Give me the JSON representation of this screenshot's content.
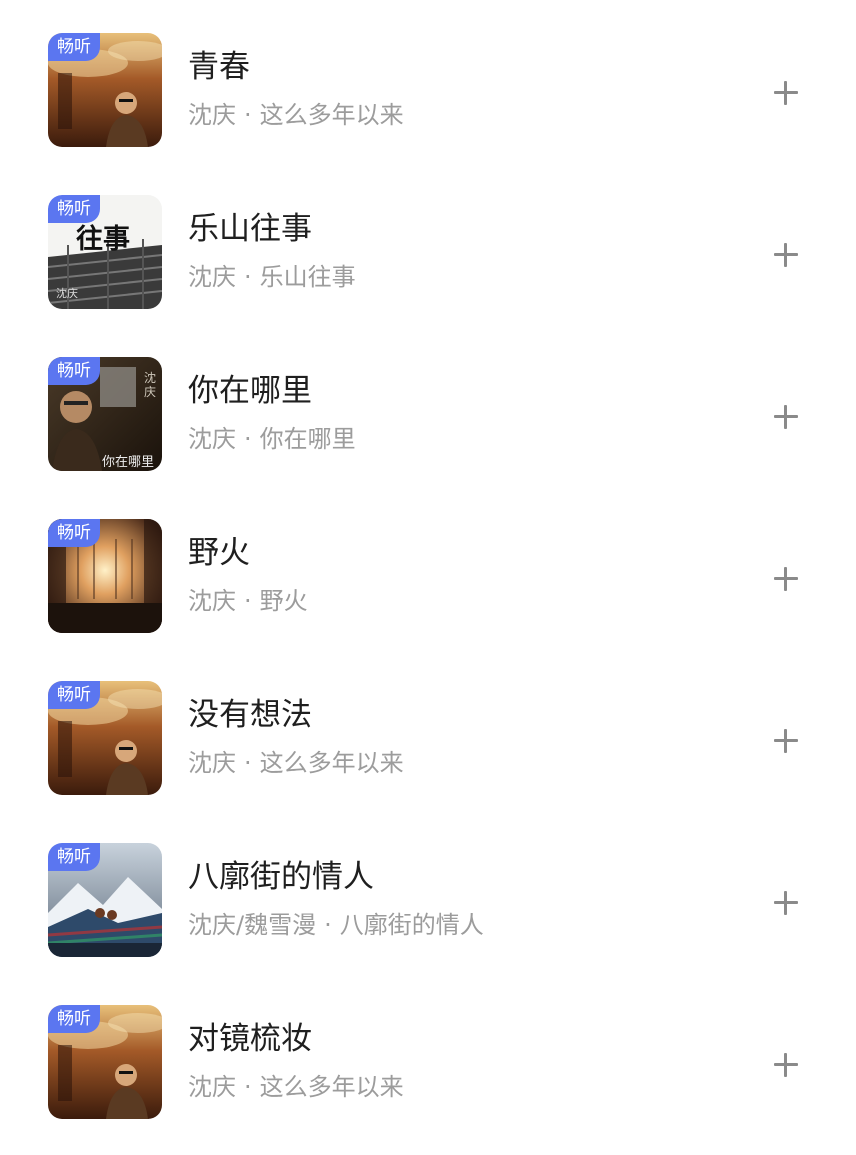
{
  "songs": [
    {
      "title": "青春",
      "artist": "沈庆",
      "album": "这么多年以来",
      "badge": "畅听",
      "cover": "cover-dusk-portrait"
    },
    {
      "title": "乐山往事",
      "artist": "沈庆",
      "album": "乐山往事",
      "badge": "畅听",
      "cover": "cover-rooftops",
      "cover_text": [
        "往事",
        "沈庆"
      ]
    },
    {
      "title": "你在哪里",
      "artist": "沈庆",
      "album": "你在哪里",
      "badge": "畅听",
      "cover": "cover-dark-portrait",
      "cover_text": [
        "沈庆",
        "你在哪里"
      ]
    },
    {
      "title": "野火",
      "artist": "沈庆",
      "album": "野火",
      "badge": "畅听",
      "cover": "cover-sunset-window"
    },
    {
      "title": "没有想法",
      "artist": "沈庆",
      "album": "这么多年以来",
      "badge": "畅听",
      "cover": "cover-dusk-portrait"
    },
    {
      "title": "八廓街的情人",
      "artist": "沈庆/魏雪漫",
      "album": "八廓街的情人",
      "badge": "畅听",
      "cover": "cover-mountains"
    },
    {
      "title": "对镜梳妆",
      "artist": "沈庆",
      "album": "这么多年以来",
      "badge": "畅听",
      "cover": "cover-dusk-portrait"
    }
  ],
  "separator": "·",
  "add_icon": "plus-icon",
  "colors": {
    "badge": "#5b76f0",
    "title": "#1f1f1f",
    "subtitle": "#9c9c9c",
    "icon": "#8a8a8a"
  }
}
